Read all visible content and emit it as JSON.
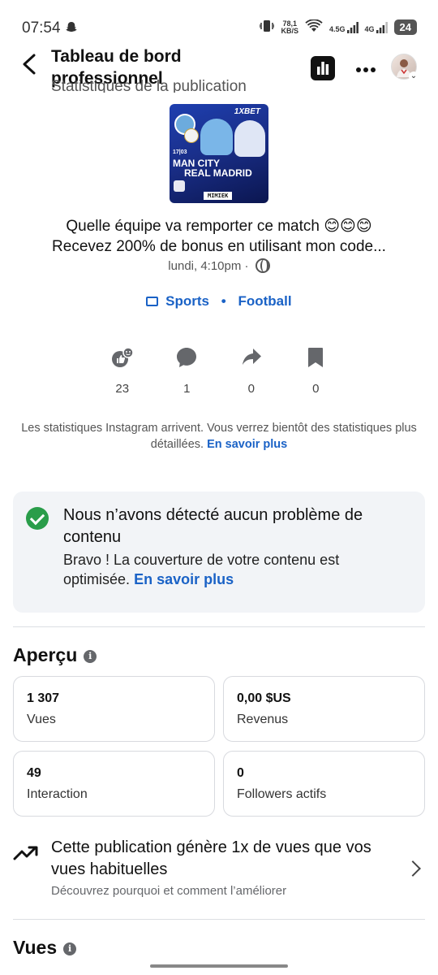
{
  "status_bar": {
    "time": "07:54",
    "net_speed_value": "78,1",
    "net_speed_unit": "KB/S",
    "signal1": "4.5G",
    "signal2": "4G",
    "battery": "24"
  },
  "header": {
    "title": "Tableau de bord professionnel",
    "subtitle": "Statistiques de la publication"
  },
  "post": {
    "thumbnail": {
      "brand": "1XBET",
      "date": "17|03",
      "team1": "MAN CITY",
      "team2": "REAL MADRID",
      "promo": "MIMIEK"
    },
    "caption_line1": "Quelle équipe va remporter ce match 😊😊😊",
    "caption_line2": "Recevez 200% de bonus en utilisant mon code...",
    "date": "lundi, 4:10pm ·",
    "tags": [
      "Sports",
      "Football"
    ]
  },
  "metrics": [
    {
      "icon": "reactions-icon",
      "value": "23"
    },
    {
      "icon": "comment-icon",
      "value": "1"
    },
    {
      "icon": "share-icon",
      "value": "0"
    },
    {
      "icon": "bookmark-icon",
      "value": "0"
    }
  ],
  "insta_note": {
    "text": "Les statistiques Instagram arrivent. Vous verrez bientôt des statistiques plus détaillées.",
    "link": "En savoir plus"
  },
  "content_check": {
    "title": "Nous n’avons détecté aucun problème de contenu",
    "body": "Bravo ! La couverture de votre contenu est optimisée.",
    "link": "En savoir plus"
  },
  "overview": {
    "title": "Aperçu",
    "cards": [
      {
        "value": "1 307",
        "label": "Vues"
      },
      {
        "value": "0,00 $US",
        "label": "Revenus"
      },
      {
        "value": "49",
        "label": "Interaction"
      },
      {
        "value": "0",
        "label": "Followers actifs"
      }
    ]
  },
  "insight": {
    "title": "Cette publication génère 1x de vues que vos vues habituelles",
    "subtitle": "Découvrez pourquoi et comment l’améliorer"
  },
  "views_section": {
    "title": "Vues"
  },
  "colors": {
    "accent": "#1a62c6",
    "success": "#2a9d4a",
    "card_bg": "#f2f4f7"
  }
}
